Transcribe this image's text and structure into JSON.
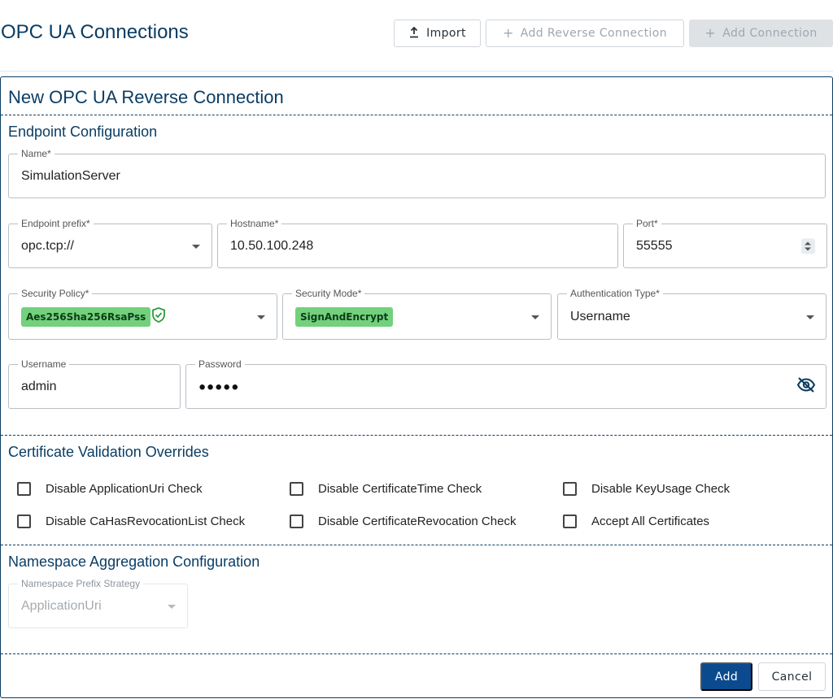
{
  "header": {
    "title": "OPC UA Connections",
    "import_label": "Import",
    "add_reverse_label": "Add Reverse Connection",
    "add_connection_label": "Add Connection"
  },
  "form": {
    "title": "New OPC UA Reverse Connection",
    "endpoint": {
      "section_title": "Endpoint Configuration",
      "name_label": "Name*",
      "name_value": "SimulationServer",
      "prefix_label": "Endpoint prefix*",
      "prefix_value": "opc.tcp://",
      "hostname_label": "Hostname*",
      "hostname_value": "10.50.100.248",
      "port_label": "Port*",
      "port_value": "55555",
      "security_policy_label": "Security Policy*",
      "security_policy_value": "Aes256Sha256RsaPss",
      "security_mode_label": "Security Mode*",
      "security_mode_value": "SignAndEncrypt",
      "auth_type_label": "Authentication Type*",
      "auth_type_value": "Username",
      "username_label": "Username",
      "username_value": "admin",
      "password_label": "Password",
      "password_mask": "●●●●●"
    },
    "certificates": {
      "section_title": "Certificate Validation Overrides",
      "options": [
        "Disable ApplicationUri Check",
        "Disable CertificateTime Check",
        "Disable KeyUsage Check",
        "Disable CaHasRevocationList Check",
        "Disable CertificateRevocation Check",
        "Accept All Certificates"
      ]
    },
    "namespace": {
      "section_title": "Namespace Aggregation Configuration",
      "strategy_label": "Namespace Prefix Strategy",
      "strategy_value": "ApplicationUri"
    },
    "add_label": "Add",
    "cancel_label": "Cancel"
  },
  "colors": {
    "primary": "#0b3d63",
    "button_primary": "#0b4a8f",
    "chip_green": "#73d17d",
    "shield_green": "#2e9a3e"
  }
}
